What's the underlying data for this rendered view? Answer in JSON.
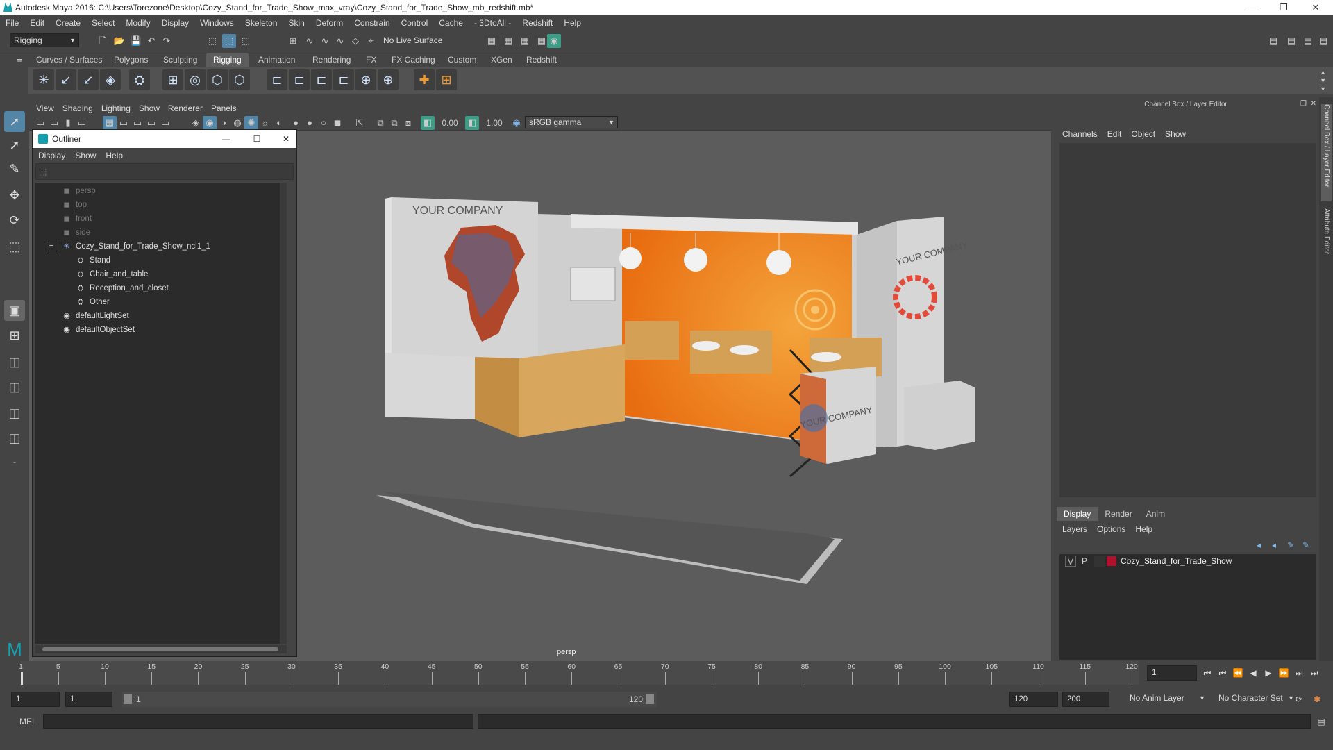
{
  "window": {
    "title": "Autodesk Maya 2016: C:\\Users\\Torezone\\Desktop\\Cozy_Stand_for_Trade_Show_max_vray\\Cozy_Stand_for_Trade_Show_mb_redshift.mb*"
  },
  "menubar": [
    "File",
    "Edit",
    "Create",
    "Select",
    "Modify",
    "Display",
    "Windows",
    "Skeleton",
    "Skin",
    "Deform",
    "Constrain",
    "Control",
    "Cache",
    "- 3DtoAll -",
    "Redshift",
    "Help"
  ],
  "statusline": {
    "mode": "Rigging",
    "live_surface": "No Live Surface"
  },
  "shelf": {
    "tabs": [
      "Curves / Surfaces",
      "Polygons",
      "Sculpting",
      "Rigging",
      "Animation",
      "Rendering",
      "FX",
      "FX Caching",
      "Custom",
      "XGen",
      "Redshift"
    ],
    "active": "Rigging"
  },
  "viewport": {
    "menus": [
      "View",
      "Shading",
      "Lighting",
      "Show",
      "Renderer",
      "Panels"
    ],
    "exposure": "0.00",
    "gamma": "1.00",
    "colorspace": "sRGB gamma",
    "camera_label": "persp",
    "signs": {
      "left_wall": "YOUR COMPANY",
      "right_wall": "YOUR COMPANY",
      "counter": "YOUR COMPANY"
    },
    "colors": {
      "bg": "#5c5c5c",
      "floor": "#555555",
      "wall": "#d2d2d2",
      "orange": "#f08a18",
      "wood": "#d7a55a"
    }
  },
  "outliner": {
    "title": "Outliner",
    "menus": [
      "Display",
      "Show",
      "Help"
    ],
    "items": [
      {
        "label": "persp",
        "kind": "camera"
      },
      {
        "label": "top",
        "kind": "camera"
      },
      {
        "label": "front",
        "kind": "camera"
      },
      {
        "label": "side",
        "kind": "camera"
      },
      {
        "label": "Cozy_Stand_for_Trade_Show_ncl1_1",
        "kind": "group"
      },
      {
        "label": "Stand",
        "kind": "child"
      },
      {
        "label": "Chair_and_table",
        "kind": "child"
      },
      {
        "label": "Reception_and_closet",
        "kind": "child"
      },
      {
        "label": "Other",
        "kind": "child"
      },
      {
        "label": "defaultLightSet",
        "kind": "set"
      },
      {
        "label": "defaultObjectSet",
        "kind": "set"
      }
    ]
  },
  "channelbox": {
    "title": "Channel Box / Layer Editor",
    "menus": [
      "Channels",
      "Edit",
      "Object",
      "Show"
    ],
    "side_tabs": [
      "Channel Box / Layer Editor",
      "Attribute Editor"
    ]
  },
  "layereditor": {
    "tabs": [
      "Display",
      "Render",
      "Anim"
    ],
    "active": "Display",
    "menus": [
      "Layers",
      "Options",
      "Help"
    ],
    "layer": {
      "v": "V",
      "p": "P",
      "name": "Cozy_Stand_for_Trade_Show",
      "color": "#b0122e"
    }
  },
  "timeline": {
    "ticks": [
      "1",
      "5",
      "10",
      "15",
      "20",
      "25",
      "30",
      "35",
      "40",
      "45",
      "50",
      "55",
      "60",
      "65",
      "70",
      "75",
      "80",
      "85",
      "90",
      "95",
      "100",
      "105",
      "110",
      "115",
      "120"
    ],
    "current_frame": "1"
  },
  "range": {
    "start": "1",
    "start2": "1",
    "slider_start": "1",
    "slider_end": "120",
    "end": "120",
    "end2": "200",
    "anim_layer": "No Anim Layer",
    "char_set": "No Character Set"
  },
  "cmd": {
    "label": "MEL"
  }
}
